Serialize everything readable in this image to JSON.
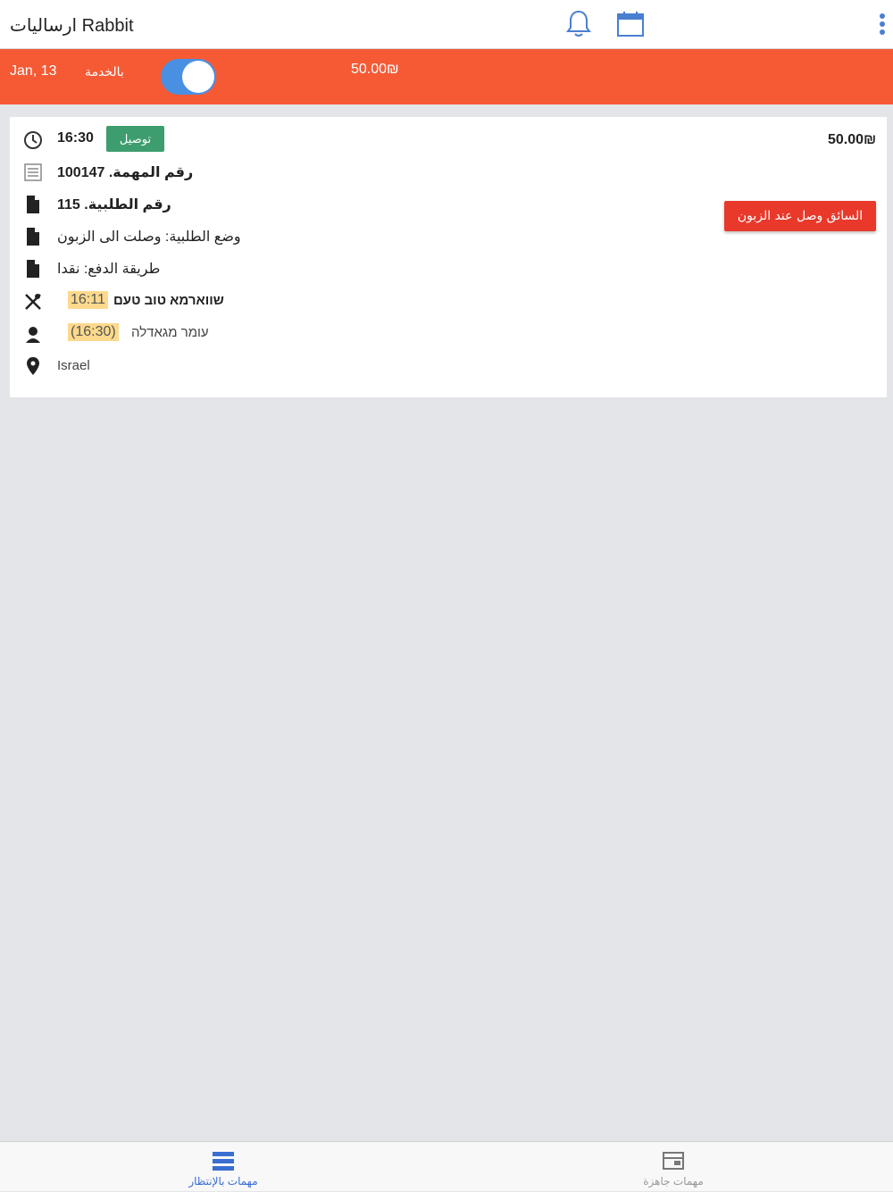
{
  "header": {
    "title": "ارساليات Rabbit",
    "icons": [
      "bell-icon",
      "calendar-icon",
      "kebab-menu-icon"
    ]
  },
  "status_bar": {
    "date": "Jan, 13",
    "service_label": "بالخدمة",
    "toggle_on": true,
    "amount": "50.00₪"
  },
  "task": {
    "time": "16:30",
    "type_badge": "توصيل",
    "task_number": "رقم المهمة. 100147",
    "order_number": "رقم الطلبية. 115",
    "order_status": "وضع الطلبية: وصلت الى الزبون",
    "payment_method": "طريقة الدفع: نقدا",
    "restaurant_time": "16:11",
    "restaurant_name": "שווארמא טוב טעם",
    "driver_time": "(16:30)",
    "driver_name": "עומר מגאדלה",
    "location": "Israel",
    "price": "50.00₪",
    "action_button": "السائق وصل عند الزبون"
  },
  "bottom_nav": {
    "tabs": [
      {
        "label": "مهمات بالإنتظار",
        "icon": "list-icon",
        "active": true
      },
      {
        "label": "مهمات جاهزة",
        "icon": "card-icon",
        "active": false
      }
    ]
  },
  "colors": {
    "accent_orange": "#f55a35",
    "badge_green": "#3e9d6e",
    "action_red": "#e8392b",
    "active_blue": "#3b6ed0"
  }
}
